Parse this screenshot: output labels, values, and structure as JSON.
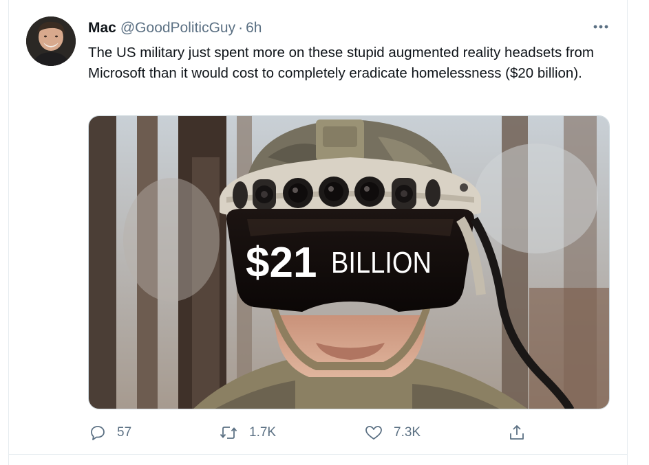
{
  "tweet": {
    "author_name": "Mac",
    "handle": "@GoodPoliticGuy",
    "separator": "·",
    "time": "6h",
    "text": "The US military just spent more on these stupid augmented reality headsets from Microsoft than it would cost to completely eradicate homelessness ($20 billion).",
    "media": {
      "overlay_amount": "$21",
      "overlay_word": "BILLION"
    },
    "actions": {
      "reply_count": "57",
      "retweet_count": "1.7K",
      "like_count": "7.3K"
    }
  },
  "colors": {
    "text_primary": "#0f1419",
    "text_secondary": "#5b7083",
    "border": "#e6ecf0"
  },
  "icons": [
    "more-icon",
    "reply-icon",
    "retweet-icon",
    "like-icon",
    "share-icon"
  ]
}
